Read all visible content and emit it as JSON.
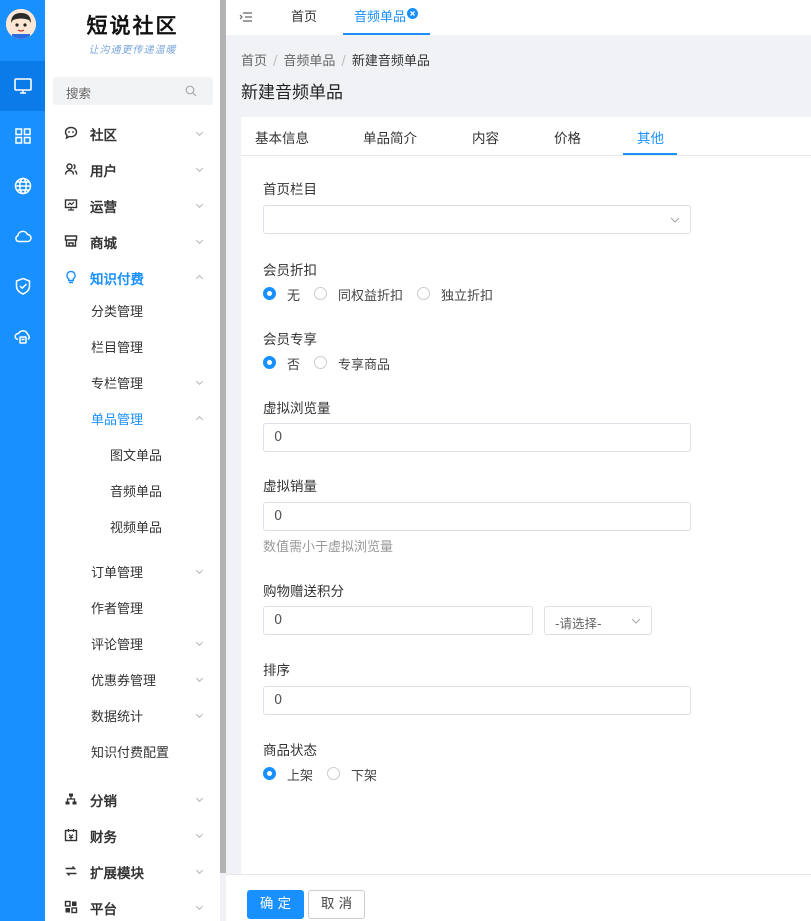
{
  "logo": {
    "title": "短说社区",
    "slogan": "让沟通更传递温暖"
  },
  "sidebar": {
    "search_placeholder": "搜索",
    "menu": [
      {
        "label": "社区"
      },
      {
        "label": "用户"
      },
      {
        "label": "运营"
      },
      {
        "label": "商城"
      },
      {
        "label": "知识付费"
      },
      {
        "label": "分销"
      },
      {
        "label": "财务"
      },
      {
        "label": "扩展模块"
      },
      {
        "label": "平台"
      }
    ],
    "knowledge_sub": [
      {
        "label": "分类管理"
      },
      {
        "label": "栏目管理"
      },
      {
        "label": "专栏管理"
      },
      {
        "label": "单品管理"
      },
      {
        "label": "订单管理"
      },
      {
        "label": "作者管理"
      },
      {
        "label": "评论管理"
      },
      {
        "label": "优惠券管理"
      },
      {
        "label": "数据统计"
      },
      {
        "label": "知识付费配置"
      }
    ],
    "single_sub": [
      {
        "label": "图文单品"
      },
      {
        "label": "音频单品"
      },
      {
        "label": "视频单品"
      }
    ]
  },
  "tabs": [
    {
      "label": "首页"
    },
    {
      "label": "音频单品"
    }
  ],
  "breadcrumb": {
    "home": "首页",
    "parent": "音频单品",
    "current": "新建音频单品",
    "sep": "/"
  },
  "page_title": "新建音频单品",
  "form_tabs": [
    {
      "label": "基本信息"
    },
    {
      "label": "单品简介"
    },
    {
      "label": "内容"
    },
    {
      "label": "价格"
    },
    {
      "label": "其他"
    }
  ],
  "form": {
    "home_column": {
      "label": "首页栏目",
      "value": ""
    },
    "member_discount": {
      "label": "会员折扣",
      "options": [
        "无",
        "同权益折扣",
        "独立折扣"
      ],
      "selected": "无"
    },
    "member_exclusive": {
      "label": "会员专享",
      "options": [
        "否",
        "专享商品"
      ],
      "selected": "否"
    },
    "virtual_views": {
      "label": "虚拟浏览量",
      "value": "0"
    },
    "virtual_sales": {
      "label": "虚拟销量",
      "value": "0",
      "hint": "数值需小于虚拟浏览量"
    },
    "points": {
      "label": "购物赠送积分",
      "value": "0",
      "select_placeholder": "-请选择-"
    },
    "sort": {
      "label": "排序",
      "value": "0"
    },
    "status": {
      "label": "商品状态",
      "options": [
        "上架",
        "下架"
      ],
      "selected": "上架"
    }
  },
  "footer": {
    "confirm": "确 定",
    "cancel": "取 消"
  },
  "colors": {
    "primary": "#1890ff",
    "rail": "#1890ff"
  }
}
